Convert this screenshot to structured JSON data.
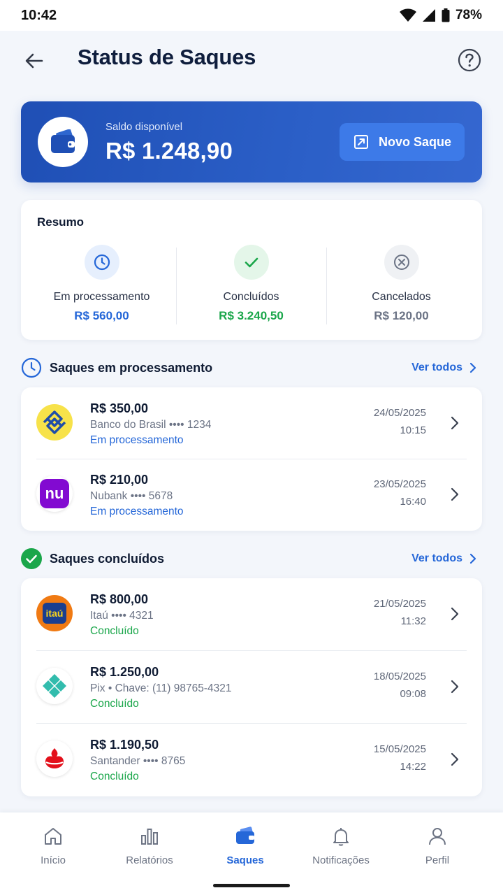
{
  "status_bar": {
    "time": "10:42",
    "battery": "78%"
  },
  "header": {
    "title": "Status de Saques"
  },
  "balance": {
    "label": "Saldo disponível",
    "value": "R$ 1.248,90",
    "button_label": "Novo Saque"
  },
  "summary": {
    "title": "Resumo",
    "items": [
      {
        "label": "Em processamento",
        "value": "R$ 560,00",
        "color": "#2567d8",
        "icon": "clock-icon"
      },
      {
        "label": "Concluídos",
        "value": "R$ 3.240,50",
        "color": "#1aa64a",
        "icon": "check-icon"
      },
      {
        "label": "Cancelados",
        "value": "R$ 120,00",
        "color": "#6b7385",
        "icon": "x-circle-icon"
      }
    ]
  },
  "processing": {
    "title": "Saques em processamento",
    "see_all": "Ver todos",
    "items": [
      {
        "amount": "R$ 350,00",
        "bank": "Banco do Brasil •••• 1234",
        "state": "Em processamento",
        "date": "24/05/2025",
        "time": "10:15",
        "logo": "banco-do-brasil-logo"
      },
      {
        "amount": "R$ 210,00",
        "bank": "Nubank •••• 5678",
        "state": "Em processamento",
        "date": "23/05/2025",
        "time": "16:40",
        "logo": "nubank-logo",
        "logo_text": "nu"
      }
    ]
  },
  "completed": {
    "title": "Saques concluídos",
    "see_all": "Ver todos",
    "items": [
      {
        "amount": "R$ 800,00",
        "bank": "Itaú •••• 4321",
        "state": "Concluído",
        "date": "21/05/2025",
        "time": "11:32",
        "logo": "itau-logo",
        "logo_text": "itaú"
      },
      {
        "amount": "R$ 1.250,00",
        "bank": "Pix • Chave: (11) 98765-4321",
        "state": "Concluído",
        "date": "18/05/2025",
        "time": "09:08",
        "logo": "pix-logo"
      },
      {
        "amount": "R$ 1.190,50",
        "bank": "Santander •••• 8765",
        "state": "Concluído",
        "date": "15/05/2025",
        "time": "14:22",
        "logo": "santander-logo"
      }
    ]
  },
  "nav": {
    "items": [
      {
        "label": "Início",
        "icon": "home-icon"
      },
      {
        "label": "Relatórios",
        "icon": "bar-chart-icon"
      },
      {
        "label": "Saques",
        "icon": "wallet-icon",
        "active": true
      },
      {
        "label": "Notificações",
        "icon": "bell-icon"
      },
      {
        "label": "Perfil",
        "icon": "user-icon"
      }
    ]
  },
  "colors": {
    "primary": "#2567d8",
    "success": "#1aa64a",
    "card_blue": "#1f4fb5"
  }
}
